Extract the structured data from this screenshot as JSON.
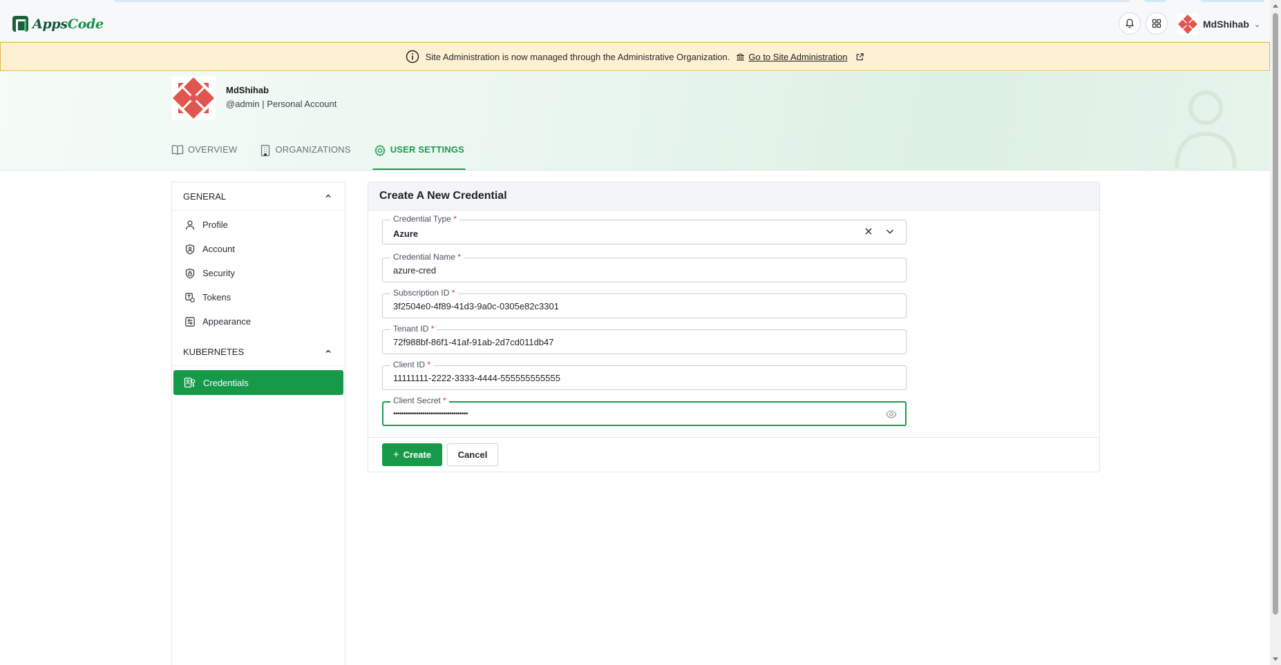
{
  "app": {
    "brand_part1": "Apps",
    "brand_part2": "Code",
    "brand_color": "#13573a"
  },
  "topnav": {
    "notification_icon": "bell-icon",
    "apps_icon": "grid-icon",
    "user_name": "MdShihab"
  },
  "banner": {
    "message": "Site Administration is now managed through the Administrative Organization.",
    "link_label": "Go to Site Administration",
    "background": "#fdf0d3"
  },
  "profile": {
    "name": "MdShihab",
    "subtitle": "@admin | Personal Account"
  },
  "tabs": [
    {
      "label": "OVERVIEW",
      "icon": "book-icon",
      "active": false
    },
    {
      "label": "ORGANIZATIONS",
      "icon": "building-icon",
      "active": false
    },
    {
      "label": "USER SETTINGS",
      "icon": "gear-icon",
      "active": true
    }
  ],
  "sidebar": {
    "general_title": "GENERAL",
    "general_items": [
      {
        "label": "Profile",
        "icon": "user-icon"
      },
      {
        "label": "Account",
        "icon": "account-shield-icon"
      },
      {
        "label": "Security",
        "icon": "security-lock-icon"
      },
      {
        "label": "Tokens",
        "icon": "token-icon"
      },
      {
        "label": "Appearance",
        "icon": "appearance-icon"
      }
    ],
    "kubernetes_title": "KUBERNETES",
    "kubernetes_items": [
      {
        "label": "Credentials",
        "icon": "credentials-icon",
        "active": true
      }
    ]
  },
  "form": {
    "title": "Create A New Credential",
    "credential_type": {
      "label": "Credential Type",
      "value": "Azure"
    },
    "credential_name": {
      "label": "Credential Name",
      "value": "azure-cred"
    },
    "subscription_id": {
      "label": "Subscription ID",
      "value": "3f2504e0-4f89-41d3-9a0c-0305e82c3301"
    },
    "tenant_id": {
      "label": "Tenant ID",
      "value": "72f988bf-86f1-41af-91ab-2d7cd011db47"
    },
    "client_id": {
      "label": "Client ID",
      "value": "11111111-2222-3333-4444-555555555555"
    },
    "client_secret": {
      "label": "Client Secret",
      "value": "••••••••••••••••••••••••••••••••••••"
    },
    "required_mark": "*",
    "create_label": "Create",
    "cancel_label": "Cancel",
    "accent": "#169a49"
  }
}
